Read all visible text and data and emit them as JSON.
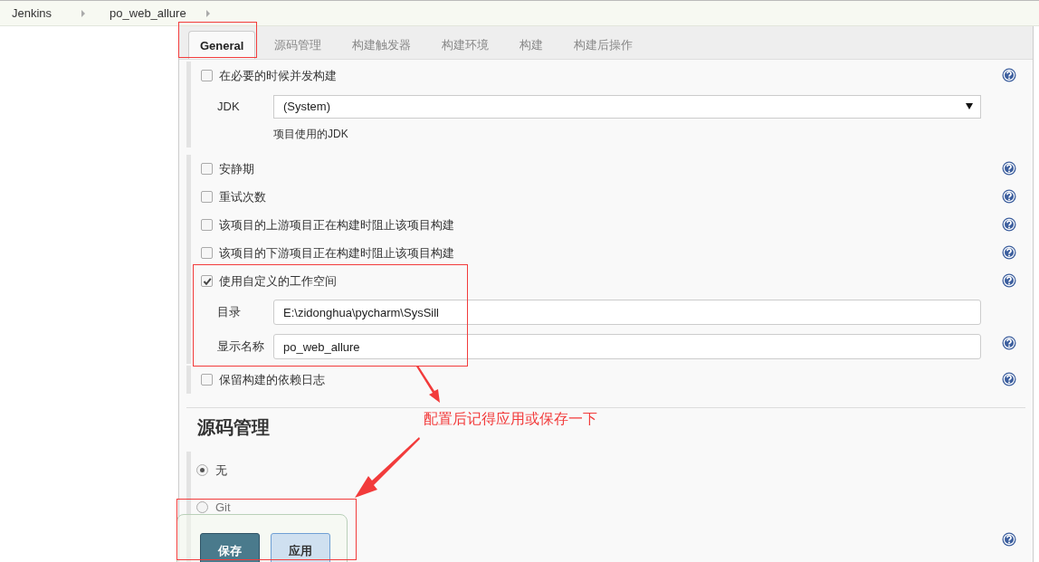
{
  "breadcrumb": [
    "Jenkins",
    "po_web_allure"
  ],
  "tabs": [
    {
      "label": "General",
      "selected": true
    },
    {
      "label": "源码管理",
      "selected": false
    },
    {
      "label": "构建触发器",
      "selected": false
    },
    {
      "label": "构建环境",
      "selected": false
    },
    {
      "label": "构建",
      "selected": false
    },
    {
      "label": "构建后操作",
      "selected": false
    }
  ],
  "general": {
    "groups": [
      {
        "items": [
          {
            "kind": "checkbox",
            "label": "在必要的时候并发构建",
            "checked": false
          },
          {
            "kind": "select",
            "label": "JDK",
            "value": "(System)"
          },
          {
            "kind": "hint",
            "text": "项目使用的JDK"
          }
        ]
      },
      {
        "items": [
          {
            "kind": "checkbox",
            "label": "安静期",
            "checked": false
          },
          {
            "kind": "checkbox",
            "label": "重试次数",
            "checked": false
          },
          {
            "kind": "checkbox",
            "label": "该项目的上游项目正在构建时阻止该项目构建",
            "checked": false
          },
          {
            "kind": "checkbox",
            "label": "该项目的下游项目正在构建时阻止该项目构建",
            "checked": false
          },
          {
            "kind": "checkbox",
            "label": "使用自定义的工作空间",
            "checked": true
          },
          {
            "kind": "field",
            "label": "目录",
            "value": "E:\\zidonghua\\pycharm\\SysSill",
            "help": false
          },
          {
            "kind": "field",
            "label": "显示名称",
            "value": "po_web_allure",
            "help": true
          }
        ]
      },
      {
        "items": [
          {
            "kind": "checkbox",
            "label": "保留构建的依赖日志",
            "checked": false
          }
        ]
      }
    ]
  },
  "scm": {
    "heading": "源码管理",
    "options": [
      {
        "label": "无",
        "selected": true
      },
      {
        "label": "Git",
        "selected": false
      }
    ]
  },
  "buttons": [
    {
      "label": "保存",
      "kind": "primary"
    },
    {
      "label": "应用",
      "kind": "secondary"
    }
  ],
  "annotation": {
    "text": "配置后记得应用或保存一下"
  }
}
